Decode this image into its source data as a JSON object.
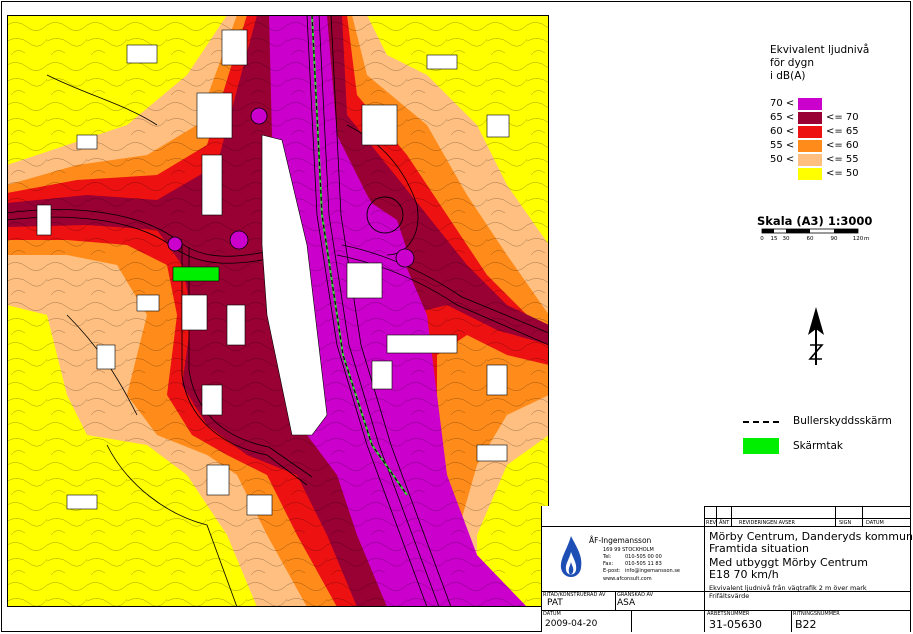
{
  "legend": {
    "title_lines": [
      "Ekvivalent ljudnivå",
      "för dygn",
      "i dB(A)"
    ],
    "rows": [
      {
        "low": "70 <",
        "high": "",
        "color": "#cc00cc"
      },
      {
        "low": "65 <",
        "high": "<= 70",
        "color": "#990033"
      },
      {
        "low": "60 <",
        "high": "<= 65",
        "color": "#ee1111"
      },
      {
        "low": "55 <",
        "high": "<= 60",
        "color": "#ff8c1a"
      },
      {
        "low": "50 <",
        "high": "<= 55",
        "color": "#ffbf80"
      },
      {
        "low": "",
        "high": "<= 50",
        "color": "#ffff00"
      }
    ]
  },
  "scale": {
    "title": "Skala (A3) 1:3000",
    "ticks": [
      "0",
      "15",
      "30",
      "60",
      "90",
      "120"
    ],
    "unit": "m"
  },
  "keys": {
    "barrier_label": "Bullerskyddsskärm",
    "roof_label": "Skärmtak"
  },
  "title_block": {
    "rev_header": "REV",
    "ant_header": "ÄNT",
    "revision_header": "REVIDERINGEN AVSER",
    "sign_header": "SIGN",
    "datum_header": "DATUM",
    "company": "ÅF-Ingemansson",
    "address": "169 99 STOCKHOLM",
    "phone_label": "Tel:",
    "phone": "010-505 00 00",
    "fax_label": "Fax:",
    "fax": "010-505 11 83",
    "email_label": "E-post:",
    "email": "info@ingemansson.se",
    "web": "www.afconsult.com",
    "project_line1": "Mörby Centrum, Danderyds kommun",
    "project_line2": "Framtida situation",
    "project_line3": "Med utbyggt Mörby Centrum",
    "project_line4": "E18 70 km/h",
    "desc_line1": "Ekvivalent ljudnivå från vägtrafik 2 m över mark",
    "desc_line2": "Frifältsvärde",
    "drawn_label": "RITAD/KONSTRUERAD AV",
    "drawn_by": "PAT",
    "checked_label": "GRANSKAD AV",
    "checked_by": "ASA",
    "date_label": "DATUM",
    "date": "2009-04-20",
    "job_label": "ARBETSNUMMER",
    "job": "31-05630",
    "drawing_label": "RITNINGSNUMMER",
    "drawing": "B22"
  },
  "colors": {
    "level_above_70": "#cc00cc",
    "level_65_70": "#990033",
    "level_60_65": "#ee1111",
    "level_55_60": "#ff8c1a",
    "level_50_55": "#ffbf80",
    "level_below_50": "#ffff00",
    "barrier_green": "#00ee00",
    "building": "#ffffff"
  },
  "icons": {
    "north": "north-arrow-icon",
    "logo": "flame-logo-icon"
  }
}
